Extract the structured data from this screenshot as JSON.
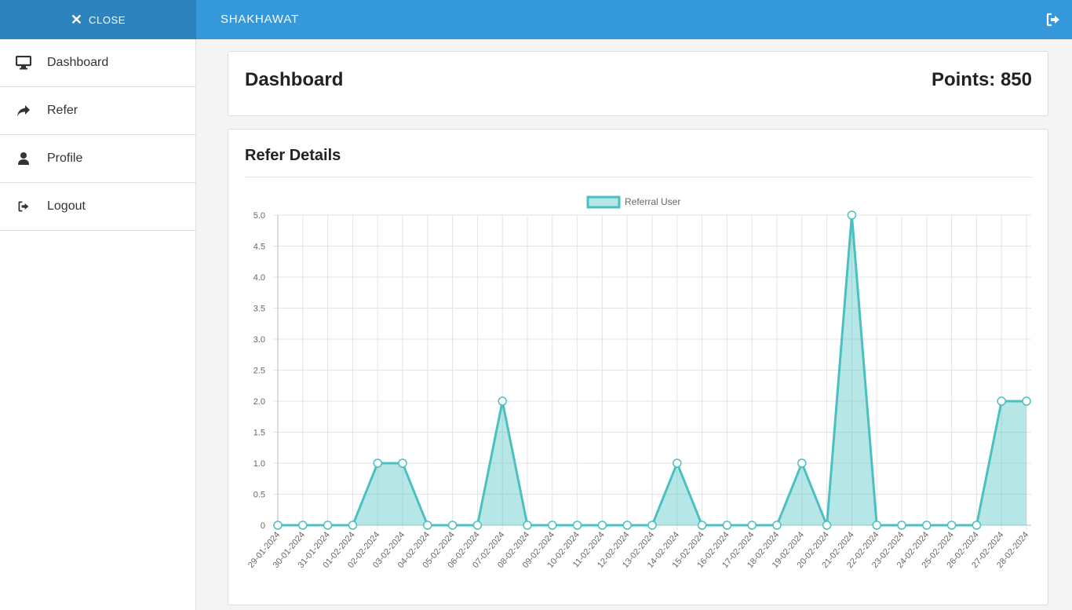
{
  "header": {
    "close_label": "CLOSE",
    "brand": "SHAKHAWAT"
  },
  "sidebar": {
    "items": [
      {
        "label": "Dashboard",
        "icon": "monitor-icon"
      },
      {
        "label": "Refer",
        "icon": "share-icon"
      },
      {
        "label": "Profile",
        "icon": "user-icon"
      },
      {
        "label": "Logout",
        "icon": "sign-out-icon"
      }
    ]
  },
  "dashboard": {
    "title": "Dashboard",
    "points_label": "Points: 850"
  },
  "refer": {
    "title": "Refer Details"
  },
  "colors": {
    "topbar": "#3498db",
    "close_tab": "#2c83be",
    "series_line": "#4bc0c0",
    "series_fill": "rgba(75,192,192,0.4)"
  },
  "chart_data": {
    "type": "area",
    "series": [
      {
        "name": "Referral User",
        "values": [
          0,
          0,
          0,
          0,
          1,
          1,
          0,
          0,
          0,
          2,
          0,
          0,
          0,
          0,
          0,
          0,
          1,
          0,
          0,
          0,
          0,
          1,
          0,
          5,
          0,
          0,
          0,
          0,
          0,
          2,
          2
        ]
      }
    ],
    "categories": [
      "29-01-2024",
      "30-01-2024",
      "31-01-2024",
      "01-02-2024",
      "02-02-2024",
      "03-02-2024",
      "04-02-2024",
      "05-02-2024",
      "06-02-2024",
      "07-02-2024",
      "08-02-2024",
      "09-02-2024",
      "10-02-2024",
      "11-02-2024",
      "12-02-2024",
      "13-02-2024",
      "14-02-2024",
      "15-02-2024",
      "16-02-2024",
      "17-02-2024",
      "18-02-2024",
      "19-02-2024",
      "20-02-2024",
      "21-02-2024",
      "22-02-2024",
      "23-02-2024",
      "24-02-2024",
      "25-02-2024",
      "26-02-2024",
      "27-02-2024",
      "28-02-2024"
    ],
    "yticks": [
      "0",
      "0.5",
      "1.0",
      "1.5",
      "2.0",
      "2.5",
      "3.0",
      "3.5",
      "4.0",
      "4.5",
      "5.0"
    ],
    "ylim": [
      0,
      5
    ],
    "grid": true,
    "legend_position": "top"
  }
}
